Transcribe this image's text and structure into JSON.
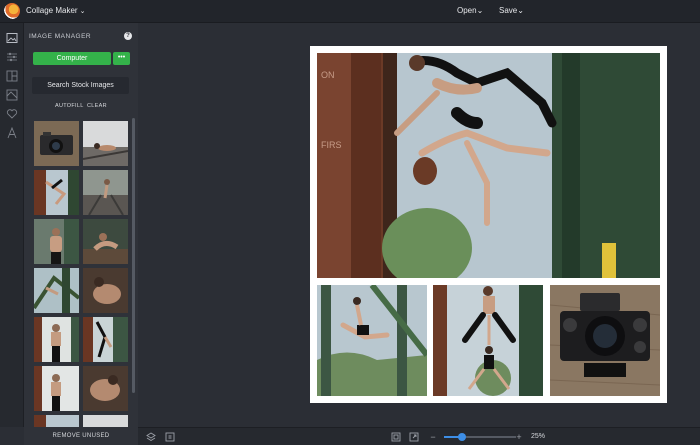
{
  "topbar": {
    "app_title": "Collage Maker",
    "open_label": "Open",
    "save_label": "Save",
    "chevron": "⌄"
  },
  "sidebar": {
    "rail_icons": [
      "image-icon",
      "sliders-icon",
      "layout-icon",
      "background-icon",
      "heart-icon",
      "text-icon"
    ],
    "panel_title": "IMAGE MANAGER",
    "help": "?",
    "computer_label": "Computer",
    "more_label": "•••",
    "stock_label": "Search Stock Images",
    "autofill_label": "AUTOFILL",
    "clear_label": "CLEAR",
    "remove_unused_label": "REMOVE UNUSED",
    "thumbnail_count": 12
  },
  "bottombar": {
    "zoom_value": "25%",
    "zoom_level": 0.25,
    "minus": "−",
    "plus": "+"
  },
  "colors": {
    "accent_green": "#34b24a",
    "accent_blue": "#3d8ee6"
  }
}
